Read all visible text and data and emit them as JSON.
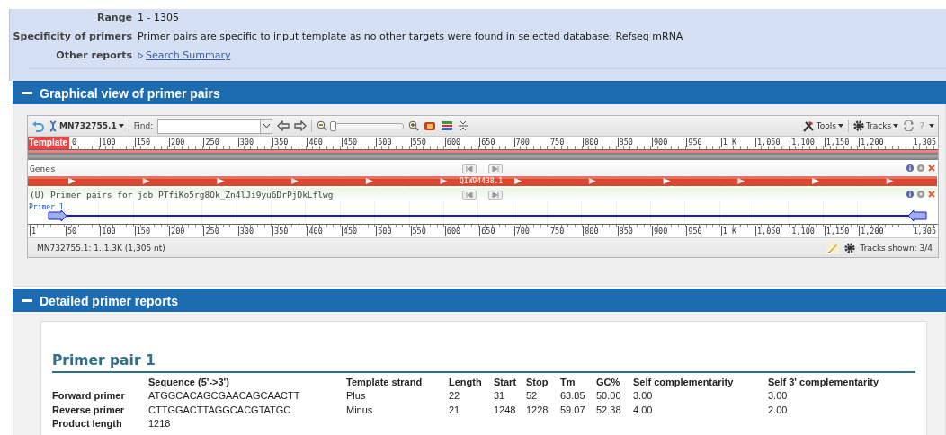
{
  "summary": {
    "rows": [
      {
        "kind": "text",
        "label": "Range",
        "value": "1 - 1305"
      },
      {
        "kind": "text",
        "label": "Specificity of primers",
        "value": "Primer pairs are specific to input template as no other targets were found in selected database: Refseq mRNA"
      },
      {
        "kind": "link",
        "label": "Other reports",
        "value": "Search Summary"
      }
    ]
  },
  "graphical_view": {
    "title": "Graphical view of primer pairs",
    "toolbar": {
      "sequence_menu": "MN732755.1",
      "find_label": "Find:",
      "zoom_slider": {
        "level": 0
      },
      "tools_menu": "Tools",
      "tracks_menu": "Tracks",
      "help_menu": "?"
    },
    "top_ruler": {
      "label": "Template",
      "ticks": [
        "0",
        "100",
        "150",
        "200",
        "250",
        "300",
        "350",
        "400",
        "450",
        "500",
        "550",
        "600",
        "650",
        "700",
        "750",
        "800",
        "850",
        "900",
        "950",
        "1 K",
        "1,050",
        "1,100",
        "1,150",
        "1,200",
        "1,305"
      ]
    },
    "tracks": [
      {
        "kind": "genes",
        "title": "Genes",
        "feature": "QIW94438.1"
      },
      {
        "kind": "primers",
        "title": "(U) Primer pairs for job PTfiKo5rg8Ok_Zn4lJi9yu6DrPjDkLflwg",
        "feature": "Primer 1"
      }
    ],
    "bottom_ruler": {
      "ticks": [
        "1",
        "50",
        "100",
        "150",
        "200",
        "250",
        "300",
        "350",
        "400",
        "450",
        "500",
        "550",
        "600",
        "650",
        "700",
        "750",
        "800",
        "850",
        "900",
        "950",
        "1 K",
        "1,050",
        "1,100",
        "1,150",
        "1,200",
        "1,305"
      ]
    },
    "status": "MN732755.1: 1..1.3K (1,305 nt)",
    "tracks_shown": "Tracks shown: 3/4"
  },
  "detailed_reports": {
    "title": "Detailed primer reports",
    "primer_pair": {
      "title": "Primer pair 1",
      "columns": [
        "Sequence (5'->3')",
        "Template strand",
        "Length",
        "Start",
        "Stop",
        "Tm",
        "GC%",
        "Self complementarity",
        "Self 3' complementarity"
      ],
      "rows": [
        {
          "label": "Forward primer",
          "cells": [
            "ATGGCACAGCGAACAGCAACTT",
            "Plus",
            "22",
            "31",
            "52",
            "63.85",
            "50.00",
            "3.00",
            "3.00"
          ]
        },
        {
          "label": "Reverse primer",
          "cells": [
            "CTTGGACTTAGGCACGTATGC",
            "Minus",
            "21",
            "1248",
            "1228",
            "59.07",
            "52.38",
            "4.00",
            "2.00"
          ]
        },
        {
          "label": "Product length",
          "cells": [
            "1218"
          ]
        }
      ]
    }
  }
}
